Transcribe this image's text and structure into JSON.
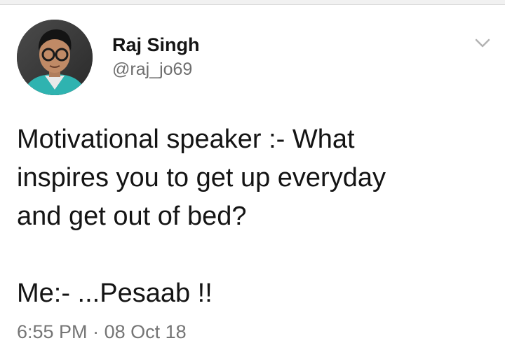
{
  "user": {
    "display_name": "Raj Singh",
    "handle": "@raj_jo69"
  },
  "tweet": {
    "text_line1": "Motivational speaker :- What",
    "text_line2": "inspires you to get up everyday",
    "text_line3": "and get out of bed?",
    "text_line4": "Me:- ...Pesaab !!",
    "time": "6:55 PM",
    "separator": "·",
    "date": "08 Oct 18"
  },
  "icons": {
    "menu": "chevron-down-icon",
    "avatar": "avatar"
  },
  "colors": {
    "text": "#141414",
    "secondary": "#6f6f6f",
    "chevron": "#b3b3b3"
  }
}
